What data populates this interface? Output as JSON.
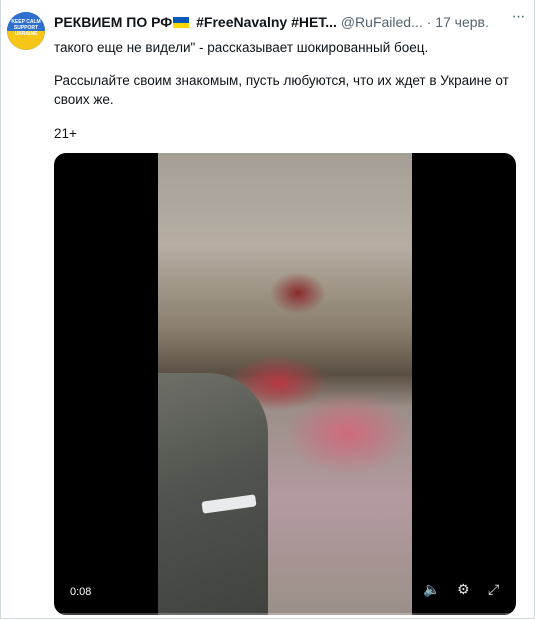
{
  "tweet": {
    "author_name": "РЕКВИЕМ ПО РФ",
    "author_tags": "#FreeNavalny #НЕТ...",
    "handle": "@RuFailed...",
    "separator": "·",
    "date": "17 черв.",
    "more_label": "···",
    "text_line1": "такого еще не видели\" - рассказывает шокированный боец.",
    "text_para2": "Рассылайте своим знакомым, пусть любуются, что их ждет в Украине от своих же.",
    "text_age": "21+",
    "avatar_text": "KEEP CALM SUPPORT UKRAINE"
  },
  "video": {
    "timestamp": "0:08",
    "volume_icon": "🔈",
    "settings_icon": "⚙",
    "fullscreen_icon": "⤢"
  },
  "colors": {
    "text": "#0f1419",
    "muted": "#536471",
    "flag_blue": "#0057b7",
    "flag_yellow": "#ffd700"
  }
}
